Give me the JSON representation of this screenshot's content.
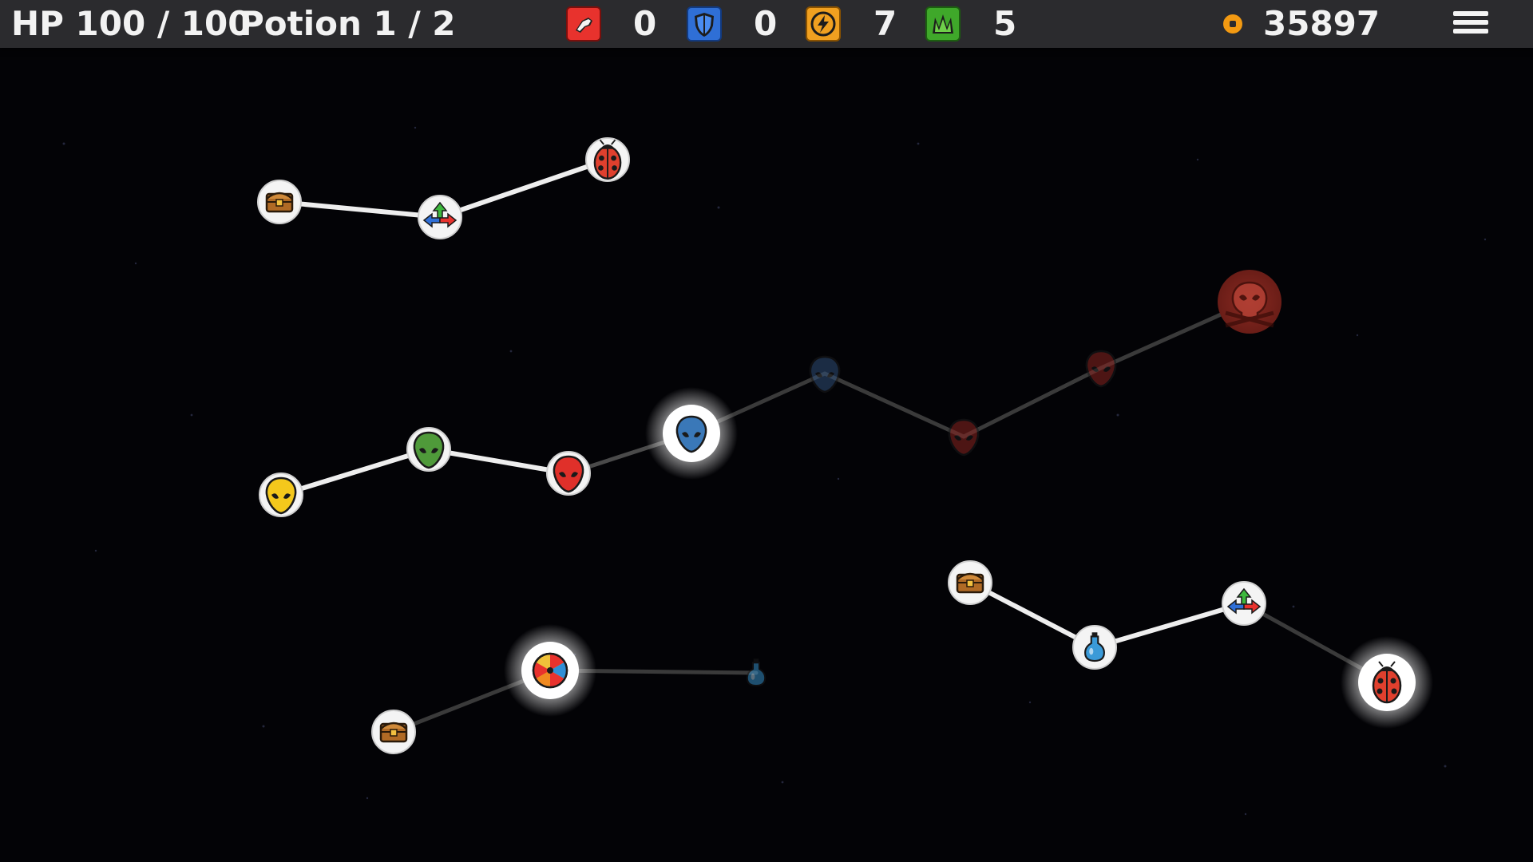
{
  "hud": {
    "hp_text": "HP 100 / 100",
    "potion_text": "Potion 1 / 2",
    "stats": [
      {
        "name": "attack",
        "icon": "fist-icon",
        "color": "#e8322d",
        "value": "0"
      },
      {
        "name": "defense",
        "icon": "shield-icon",
        "color": "#2f6fd6",
        "value": "0"
      },
      {
        "name": "energy",
        "icon": "lightning-icon",
        "color": "#f0a020",
        "value": "7"
      },
      {
        "name": "growth",
        "icon": "grass-icon",
        "color": "#3fa82a",
        "value": "5"
      }
    ],
    "coins_icon": "coin-icon",
    "coins": "35897",
    "menu_icon": "hamburger-menu-icon"
  },
  "map": {
    "nodes": [
      {
        "id": "chest-1",
        "type": "treasure-chest",
        "state": "available"
      },
      {
        "id": "swap-1",
        "type": "swap-arrows",
        "state": "available"
      },
      {
        "id": "ladybug-1",
        "type": "ladybug-enemy",
        "state": "available"
      },
      {
        "id": "alien-yellow",
        "type": "alien-yellow",
        "state": "available"
      },
      {
        "id": "alien-green",
        "type": "alien-green",
        "state": "available"
      },
      {
        "id": "alien-red-1",
        "type": "alien-red",
        "state": "available"
      },
      {
        "id": "alien-blue-current",
        "type": "alien-blue",
        "state": "current"
      },
      {
        "id": "alien-blue-dim",
        "type": "alien-blue",
        "state": "locked"
      },
      {
        "id": "alien-red-dim-1",
        "type": "alien-red",
        "state": "locked"
      },
      {
        "id": "alien-red-dim-2",
        "type": "alien-red",
        "state": "locked"
      },
      {
        "id": "skull-boss",
        "type": "skull-boss",
        "state": "locked"
      },
      {
        "id": "chest-2",
        "type": "treasure-chest",
        "state": "available"
      },
      {
        "id": "wheel",
        "type": "prize-wheel",
        "state": "current"
      },
      {
        "id": "potion-dim",
        "type": "potion",
        "state": "locked"
      },
      {
        "id": "chest-3",
        "type": "treasure-chest",
        "state": "available"
      },
      {
        "id": "potion-1",
        "type": "potion",
        "state": "available"
      },
      {
        "id": "swap-2",
        "type": "swap-arrows",
        "state": "available"
      },
      {
        "id": "ladybug-2",
        "type": "ladybug-enemy",
        "state": "current"
      }
    ]
  }
}
